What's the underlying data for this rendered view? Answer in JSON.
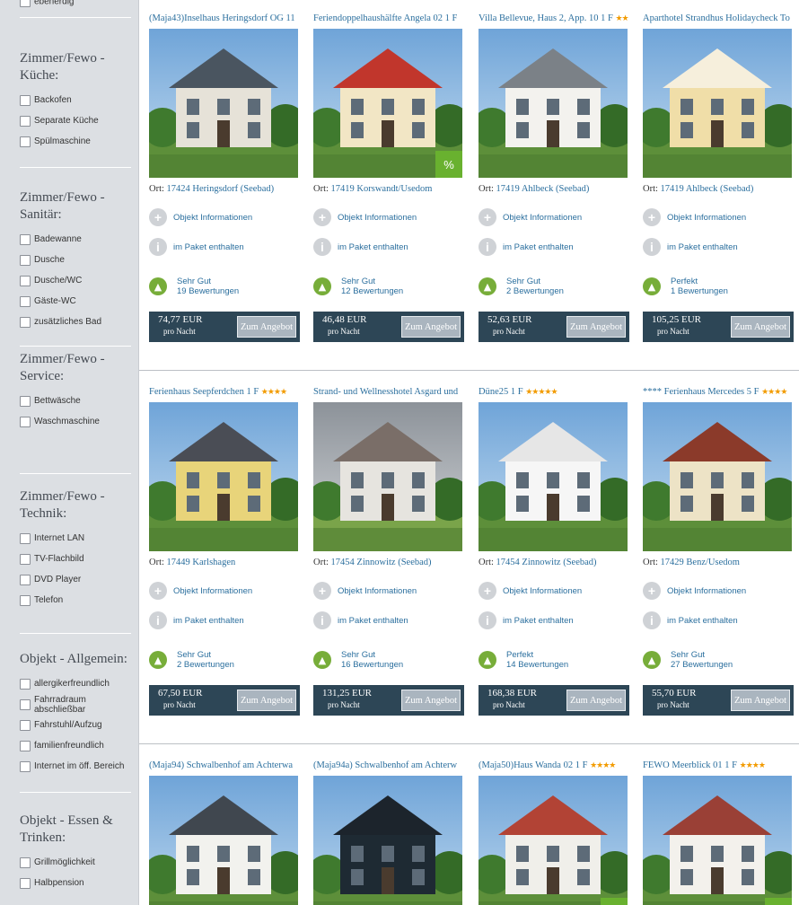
{
  "sidebar": {
    "top_option": "ebenerdig",
    "sections": [
      {
        "title": "Zimmer/Fewo - Küche:",
        "options": [
          "Backofen",
          "Separate Küche",
          "Spülmaschine"
        ]
      },
      {
        "title": "Zimmer/Fewo - Sanitär:",
        "options": [
          "Badewanne",
          "Dusche",
          "Dusche/WC",
          "Gäste-WC",
          "zusätzliches Bad"
        ]
      },
      {
        "title": "Zimmer/Fewo - Service:",
        "options": [
          "Bettwäsche",
          "Waschmaschine"
        ]
      },
      {
        "title": "Zimmer/Fewo - Technik:",
        "options": [
          "Internet LAN",
          "TV-Flachbild",
          "DVD Player",
          "Telefon"
        ]
      },
      {
        "title": "Objekt - Allgemein:",
        "options": [
          "allergikerfreundlich",
          "Fahrradraum abschließbar",
          "Fahrstuhl/Aufzug",
          "familienfreundlich",
          "Internet im öff. Bereich"
        ]
      },
      {
        "title": "Objekt - Essen & Trinken:",
        "options": [
          "Grillmöglichkeit",
          "Halbpension"
        ]
      }
    ]
  },
  "common": {
    "ort_label": "Ort:",
    "info_label": "Objekt Informationen",
    "paket_label": "im Paket enthalten",
    "pro_nacht": "pro Nacht",
    "angebot_label": "Zum Angebot",
    "plus_icon": "+",
    "info_icon": "i",
    "badge_text": "%"
  },
  "listings": [
    {
      "title": "(Maja43)Inselhaus Heringsdorf OG 11",
      "stars": "",
      "ort": "17424 Heringsdorf (Seebad)",
      "rating": "Sehr Gut",
      "reviews": "19 Bewertungen",
      "price": "74,77 EUR",
      "badge": false
    },
    {
      "title": "Feriendoppelhaushälfte Angela 02  1 F",
      "stars": "",
      "ort": "17419 Korswandt/Usedom",
      "rating": "Sehr Gut",
      "reviews": "12 Bewertungen",
      "price": "46,48 EUR",
      "badge": true
    },
    {
      "title": "Villa Bellevue, Haus 2, App. 10  1 F",
      "stars": "★★",
      "ort": "17419 Ahlbeck (Seebad)",
      "rating": "Sehr Gut",
      "reviews": "2 Bewertungen",
      "price": "52,63 EUR",
      "badge": false
    },
    {
      "title": "Aparthotel Strandhus Holidaycheck To",
      "stars": "",
      "ort": "17419 Ahlbeck (Seebad)",
      "rating": "Perfekt",
      "reviews": "1 Bewertungen",
      "price": "105,25 EUR",
      "badge": false
    },
    {
      "title": "Ferienhaus Seepferdchen  1 F",
      "stars": "★★★★",
      "ort": "17449 Karlshagen",
      "rating": "Sehr Gut",
      "reviews": "2 Bewertungen",
      "price": "67,50 EUR",
      "badge": false
    },
    {
      "title": "Strand- und Wellnesshotel Asgard und",
      "stars": "",
      "ort": "17454 Zinnowitz (Seebad)",
      "rating": "Sehr Gut",
      "reviews": "16 Bewertungen",
      "price": "131,25 EUR",
      "badge": false
    },
    {
      "title": "Düne25  1 F",
      "stars": "★★★★★",
      "ort": "17454 Zinnowitz (Seebad)",
      "rating": "Perfekt",
      "reviews": "14 Bewertungen",
      "price": "168,38 EUR",
      "badge": false
    },
    {
      "title": "**** Ferienhaus Mercedes  5 F",
      "stars": "★★★★",
      "ort": "17429 Benz/Usedom",
      "rating": "Sehr Gut",
      "reviews": "27 Bewertungen",
      "price": "55,70 EUR",
      "badge": false
    },
    {
      "title": "(Maja94) Schwalbenhof am Achterwa",
      "stars": "",
      "ort": "",
      "rating": "",
      "reviews": "",
      "price": "",
      "badge": false
    },
    {
      "title": "(Maja94a) Schwalbenhof am Achterw",
      "stars": "",
      "ort": "",
      "rating": "",
      "reviews": "",
      "price": "",
      "badge": false
    },
    {
      "title": "(Maja50)Haus Wanda 02  1 F",
      "stars": "★★★★",
      "ort": "",
      "rating": "",
      "reviews": "",
      "price": "",
      "badge": true
    },
    {
      "title": "FEWO Meerblick 01  1 F",
      "stars": "★★★★",
      "ort": "",
      "rating": "",
      "reviews": "",
      "price": "",
      "badge": true
    }
  ]
}
